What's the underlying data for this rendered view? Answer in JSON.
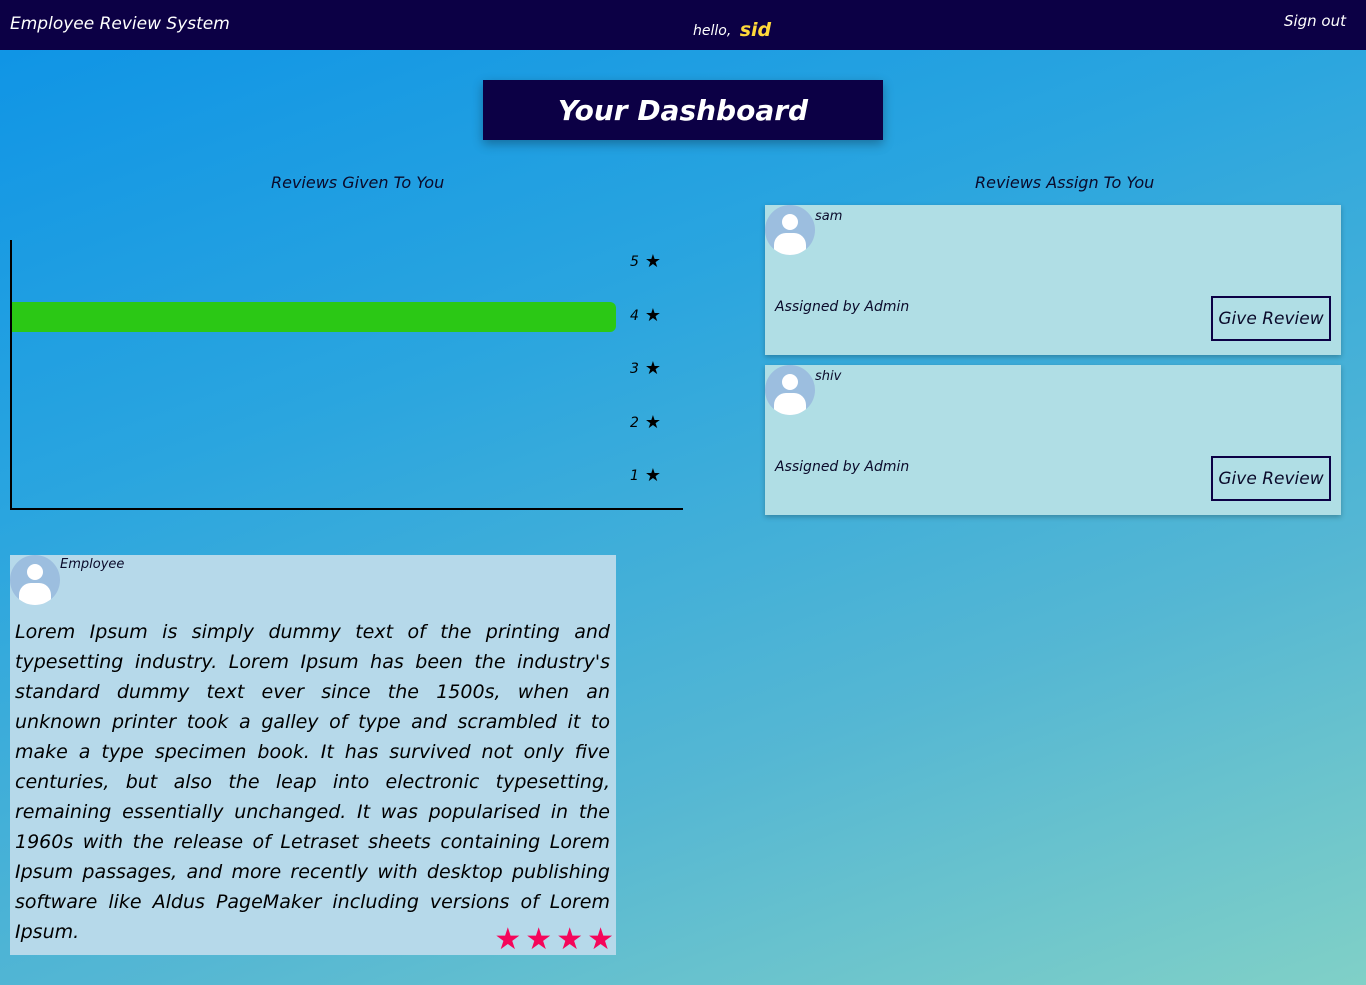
{
  "navbar": {
    "brand": "Employee Review System",
    "greeting": "hello,",
    "username": "sid",
    "signout": "Sign out"
  },
  "dashboard": {
    "title": "Your Dashboard"
  },
  "reviews_given": {
    "heading": "Reviews Given To You",
    "chart_data": {
      "type": "bar",
      "orientation": "horizontal",
      "categories": [
        "5",
        "4",
        "3",
        "2",
        "1"
      ],
      "values": [
        0,
        1,
        0,
        0,
        0
      ],
      "bar_color": "#2bc815"
    },
    "star_icon": "star-icon"
  },
  "reviews_assigned": {
    "heading": "Reviews Assign To You",
    "items": [
      {
        "name": "sam",
        "assigned_by": "Assigned by Admin",
        "button": "Give Review"
      },
      {
        "name": "shiv",
        "assigned_by": "Assigned by Admin",
        "button": "Give Review"
      }
    ]
  },
  "review_card": {
    "author": "Employee",
    "text": "Lorem Ipsum is simply dummy text of the printing and typesetting industry. Lorem Ipsum has been the industry's standard dummy text ever since the 1500s, when an unknown printer took a galley of type and scrambled it to make a type specimen book. It has survived not only five centuries, but also the leap into electronic typesetting, remaining essentially unchanged. It was popularised in the 1960s with the release of Letraset sheets containing Lorem Ipsum passages, and more recently with desktop publishing software like Aldus PageMaker including versions of Lorem Ipsum.",
    "rating": 4,
    "star_color": "#f5055a"
  },
  "colors": {
    "navbar": "#0c0045",
    "accent_username": "#ffd83a"
  }
}
